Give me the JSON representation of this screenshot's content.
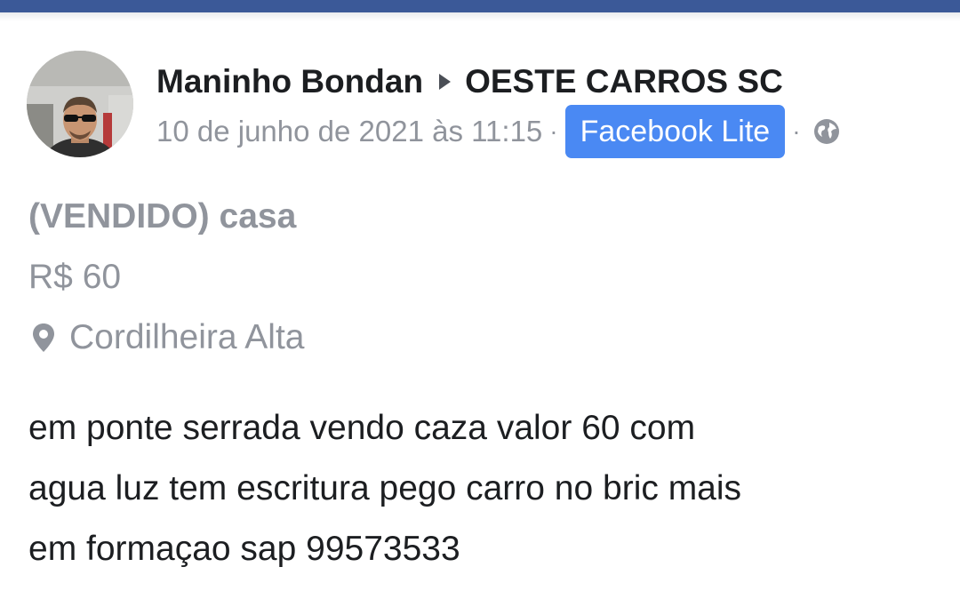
{
  "post": {
    "author": "Maninho Bondan",
    "group": "OESTE CARROS SC",
    "timestamp": "10 de junho de 2021 às 11:15",
    "separator": "·",
    "app_badge": "Facebook Lite",
    "privacy_icon": "globe-icon",
    "avatar_icon": "profile-photo"
  },
  "listing": {
    "title": "(VENDIDO) casa",
    "price": "R$ 60",
    "location": "Cordilheira Alta",
    "location_icon": "map-pin-icon"
  },
  "body": {
    "lines": [
      "em ponte serrada vendo caza valor 60 com",
      "agua luz tem escritura pego carro no bric mais",
      "em formaçao sap 99573533"
    ]
  },
  "colors": {
    "brand_bar": "#3b5998",
    "badge_bg": "#4a89f3",
    "muted_text": "#90949c",
    "primary_text": "#1c1e21"
  }
}
